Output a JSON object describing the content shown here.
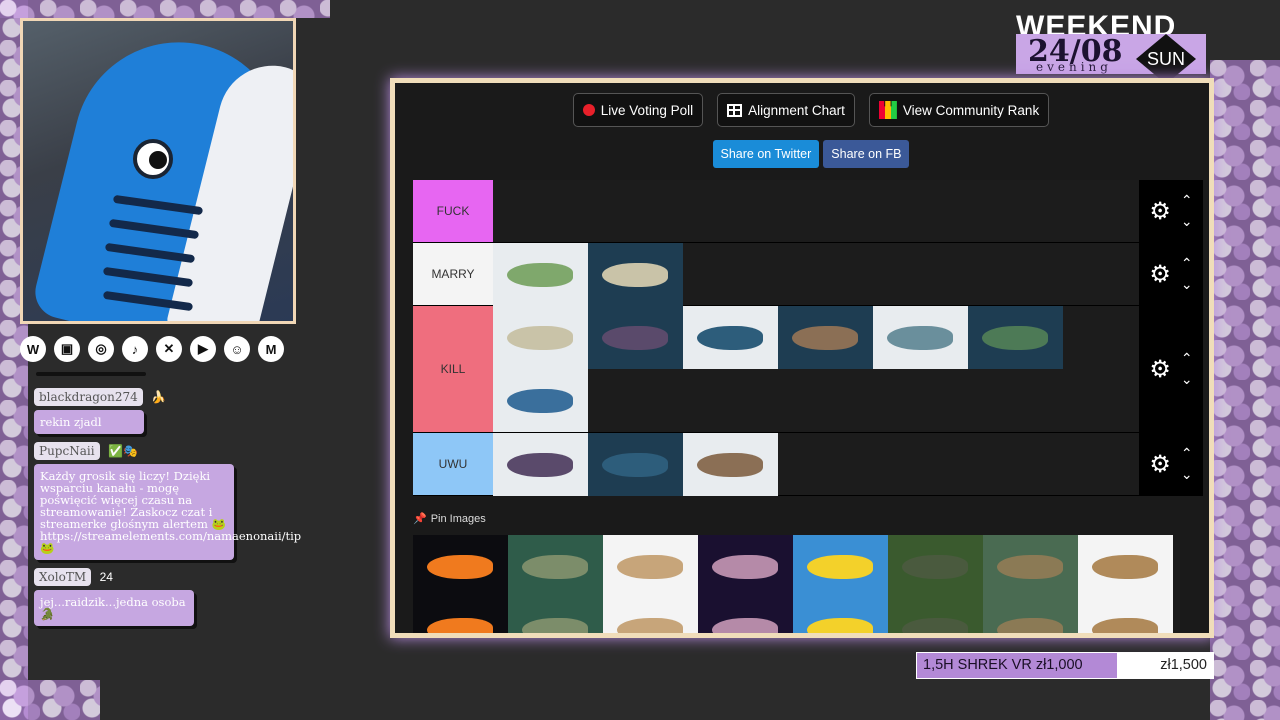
{
  "overlay": {
    "logo": {
      "title": "WEEKEND",
      "date": "24/08",
      "day": "SUN",
      "time_of_day": "evening"
    },
    "socials": [
      "wordpress-icon",
      "twitch-icon",
      "instagram-icon",
      "tiktok-icon",
      "x-icon",
      "youtube-icon",
      "discord-icon",
      "gmail-icon"
    ],
    "goal": {
      "label": "1,5H SHREK VR zł1,000",
      "target": "zł1,500"
    }
  },
  "chat": {
    "messages": [
      {
        "user": "blackdragon274",
        "badge": "🍌",
        "text": "rekin zjadl"
      },
      {
        "user": "PupcNaii",
        "badge": "✅🎭",
        "text": "Każdy grosik się liczy! Dzięki wsparciu kanału - mogę poświęcić więcej czasu na streamowanie! Zaskocz czat i streamerke głośnym alertem 🐸 https://streamelements.com/namaenonaii/tip 🐸"
      },
      {
        "user": "XoloTM",
        "badge": "24",
        "text": "jej...raidzik...jedna osoba 🐊"
      }
    ]
  },
  "tierlist": {
    "buttons": {
      "poll": "Live Voting Poll",
      "alignment": "Alignment Chart",
      "community": "View Community Rank"
    },
    "share": {
      "twitter": "Share on Twitter",
      "fb": "Share on FB"
    },
    "tiers": [
      {
        "label": "FUCK",
        "color": "#e766f2",
        "items": []
      },
      {
        "label": "MARRY",
        "color": "#f4f4f4",
        "items": [
          "sailfish",
          "cleaner wrasse"
        ]
      },
      {
        "label": "KILL",
        "color": "#ef6e7e",
        "items": [
          "eel",
          "barracuda",
          "bass",
          "anglerfish sketch",
          "grouper",
          "catfish",
          "tilapia"
        ]
      },
      {
        "label": "UWU",
        "color": "#8ec7f7",
        "items": [
          "archerfish",
          "blobfish",
          "chimaera"
        ]
      }
    ],
    "pin_title": "Pin Images",
    "pinned": [
      "clownfish",
      "grouper",
      "cusk eel",
      "deep-sea fish",
      "yellow damselfish",
      "lamprey",
      "wobbegong",
      "flounder",
      "sunfish",
      "scorpionfish",
      "needlefish",
      "ray",
      "carp",
      "pike",
      "sturgeon",
      "shark"
    ]
  }
}
